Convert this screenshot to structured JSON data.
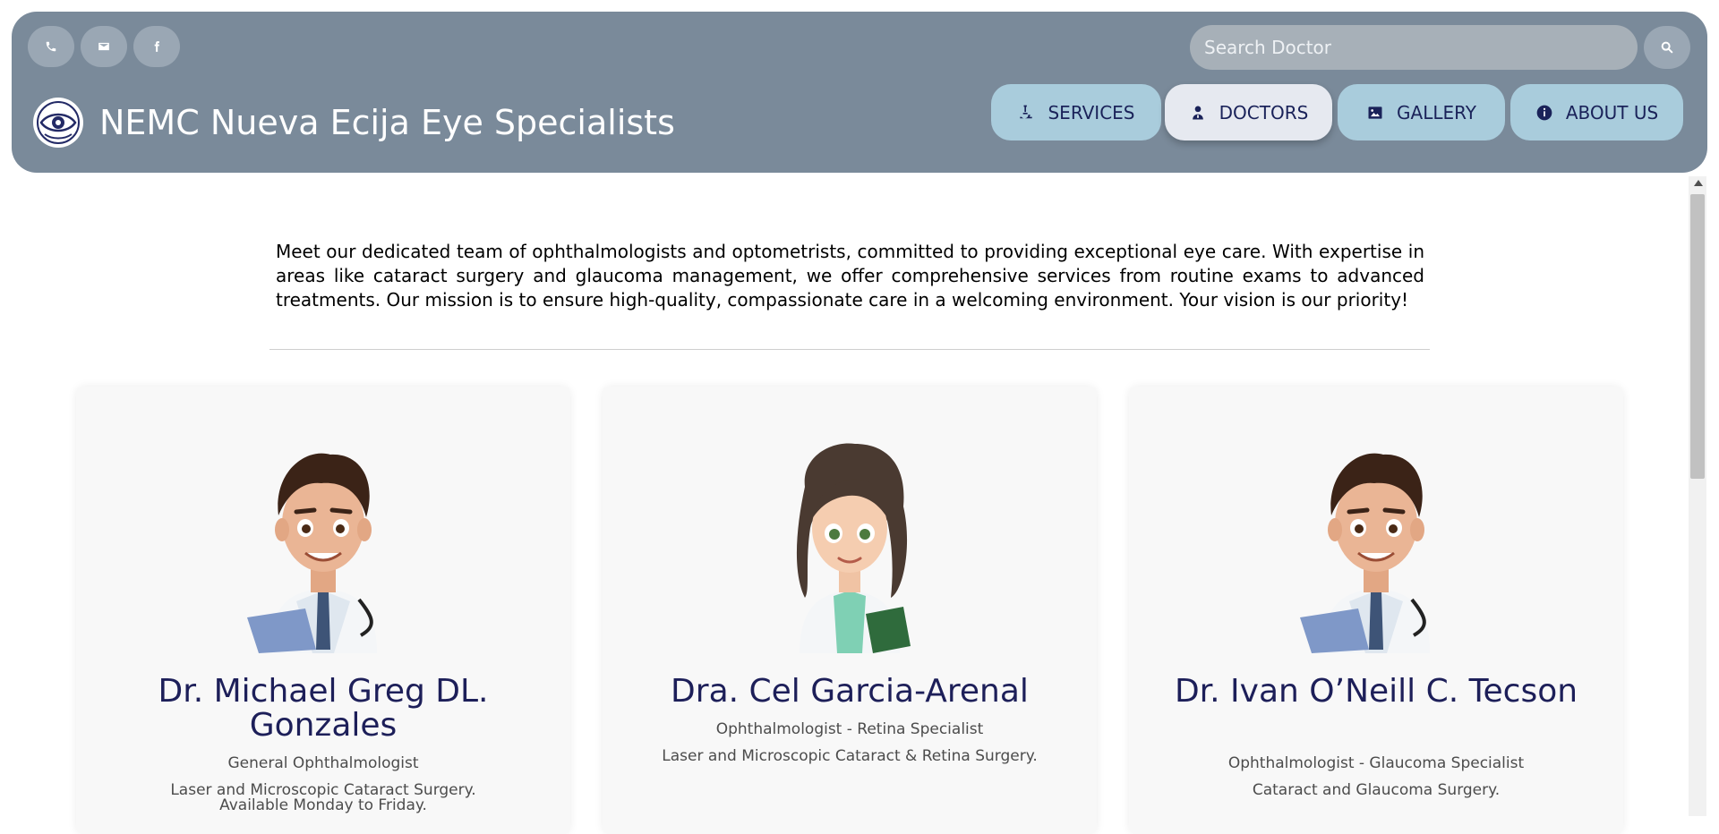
{
  "header": {
    "title": "NEMC Nueva Ecija Eye Specialists",
    "search_placeholder": "Search Doctor",
    "social_icons": [
      "phone-icon",
      "envelope-icon",
      "facebook-icon"
    ],
    "nav": [
      {
        "label": "SERVICES",
        "icon": "microscope-icon",
        "active": false
      },
      {
        "label": "DOCTORS",
        "icon": "doctor-icon",
        "active": true
      },
      {
        "label": "GALLERY",
        "icon": "image-icon",
        "active": false
      },
      {
        "label": "ABOUT US",
        "icon": "info-icon",
        "active": false
      }
    ]
  },
  "intro": "Meet our dedicated team of ophthalmologists and optometrists, committed to providing exceptional eye care. With expertise in areas like cataract surgery and glaucoma management, we offer comprehensive services from routine exams to advanced treatments. Our mission is to ensure high-quality, compassionate care in a welcoming environment. Your vision is our priority!",
  "doctors": [
    {
      "name": "Dr. Michael Greg DL. Gonzales",
      "specialty": "General Ophthalmologist",
      "details": [
        "Laser and Microscopic Cataract Surgery.",
        "Available Monday to Friday."
      ]
    },
    {
      "name": "Dra. Cel Garcia-Arenal",
      "specialty": "Ophthalmologist - Retina Specialist",
      "details": [
        "Laser and Microscopic Cataract & Retina Surgery."
      ]
    },
    {
      "name": "Dr. Ivan O’Neill C. Tecson",
      "specialty": "Ophthalmologist - Glaucoma Specialist",
      "details": [
        "Cataract and Glaucoma Surgery."
      ]
    }
  ],
  "colors": {
    "header_bg": "#7a8a9a",
    "nav_bg": "#a9ccdc",
    "nav_active_bg": "#e6e9f0",
    "nav_text": "#1a2259",
    "doctor_name": "#1d1f59"
  }
}
